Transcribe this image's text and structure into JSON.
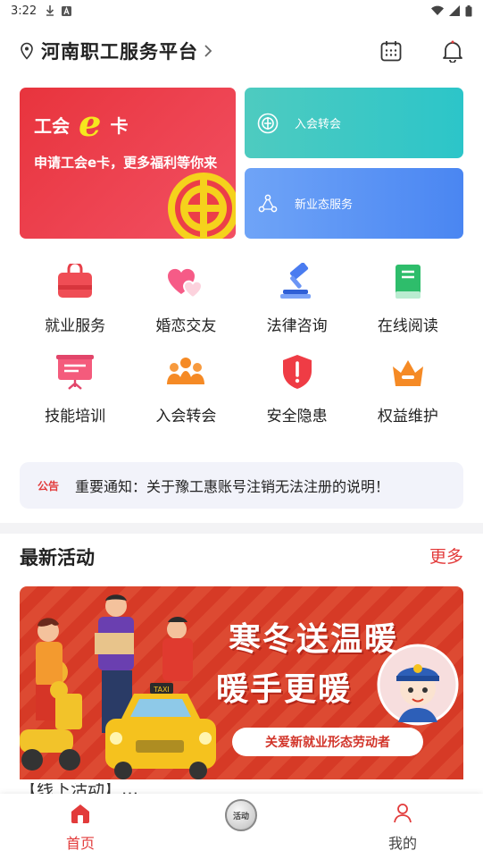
{
  "status_bar": {
    "time": "3:22",
    "icons_left": [
      "download-icon",
      "a-icon"
    ],
    "icons_right": [
      "wifi-icon",
      "signal-icon",
      "battery-icon"
    ]
  },
  "header": {
    "title": "河南职工服务平台",
    "icons": [
      "location-icon",
      "chevron-right-icon",
      "calendar-icon",
      "bell-icon"
    ]
  },
  "banners": {
    "main": {
      "title_left": "工会",
      "title_e": "e",
      "title_right": "卡",
      "subtitle": "申请工会e卡，更多福利等你来"
    },
    "small": [
      {
        "label": "入会转会",
        "icon": "union-emblem-icon"
      },
      {
        "label": "新业态服务",
        "icon": "network-icon"
      }
    ]
  },
  "services": [
    {
      "label": "就业服务",
      "icon": "bag-icon"
    },
    {
      "label": "婚恋交友",
      "icon": "hearts-icon"
    },
    {
      "label": "法律咨询",
      "icon": "gavel-icon"
    },
    {
      "label": "在线阅读",
      "icon": "book-icon"
    },
    {
      "label": "技能培训",
      "icon": "presentation-board-icon"
    },
    {
      "label": "入会转会",
      "icon": "group-icon"
    },
    {
      "label": "安全隐患",
      "icon": "shield-alert-icon"
    },
    {
      "label": "权益维护",
      "icon": "crown-icon"
    }
  ],
  "notice": {
    "tag": "公告",
    "text": "重要通知：关于豫工惠账号注销无法注册的说明！"
  },
  "activities": {
    "title": "最新活动",
    "more": "更多",
    "card": {
      "headline_1": "寒冬送温暖",
      "headline_2": "暖手更暖",
      "pill": "关爱新就业形态劳动者",
      "taxi_sign": "TAXI"
    },
    "next_title_peek": "【线下活动】…"
  },
  "tabbar": {
    "tabs": [
      {
        "label": "首页",
        "icon": "home-icon",
        "active": true
      },
      {
        "label": "活动",
        "icon": "activity-ball-icon",
        "active": false
      },
      {
        "label": "我的",
        "icon": "user-icon",
        "active": false
      }
    ]
  },
  "colors": {
    "accent": "#e23b3b",
    "banner_main": "#ec3e48",
    "banner_teal": "#36c7c5",
    "banner_blue": "#5a93f4",
    "card_red": "#d63a26"
  }
}
